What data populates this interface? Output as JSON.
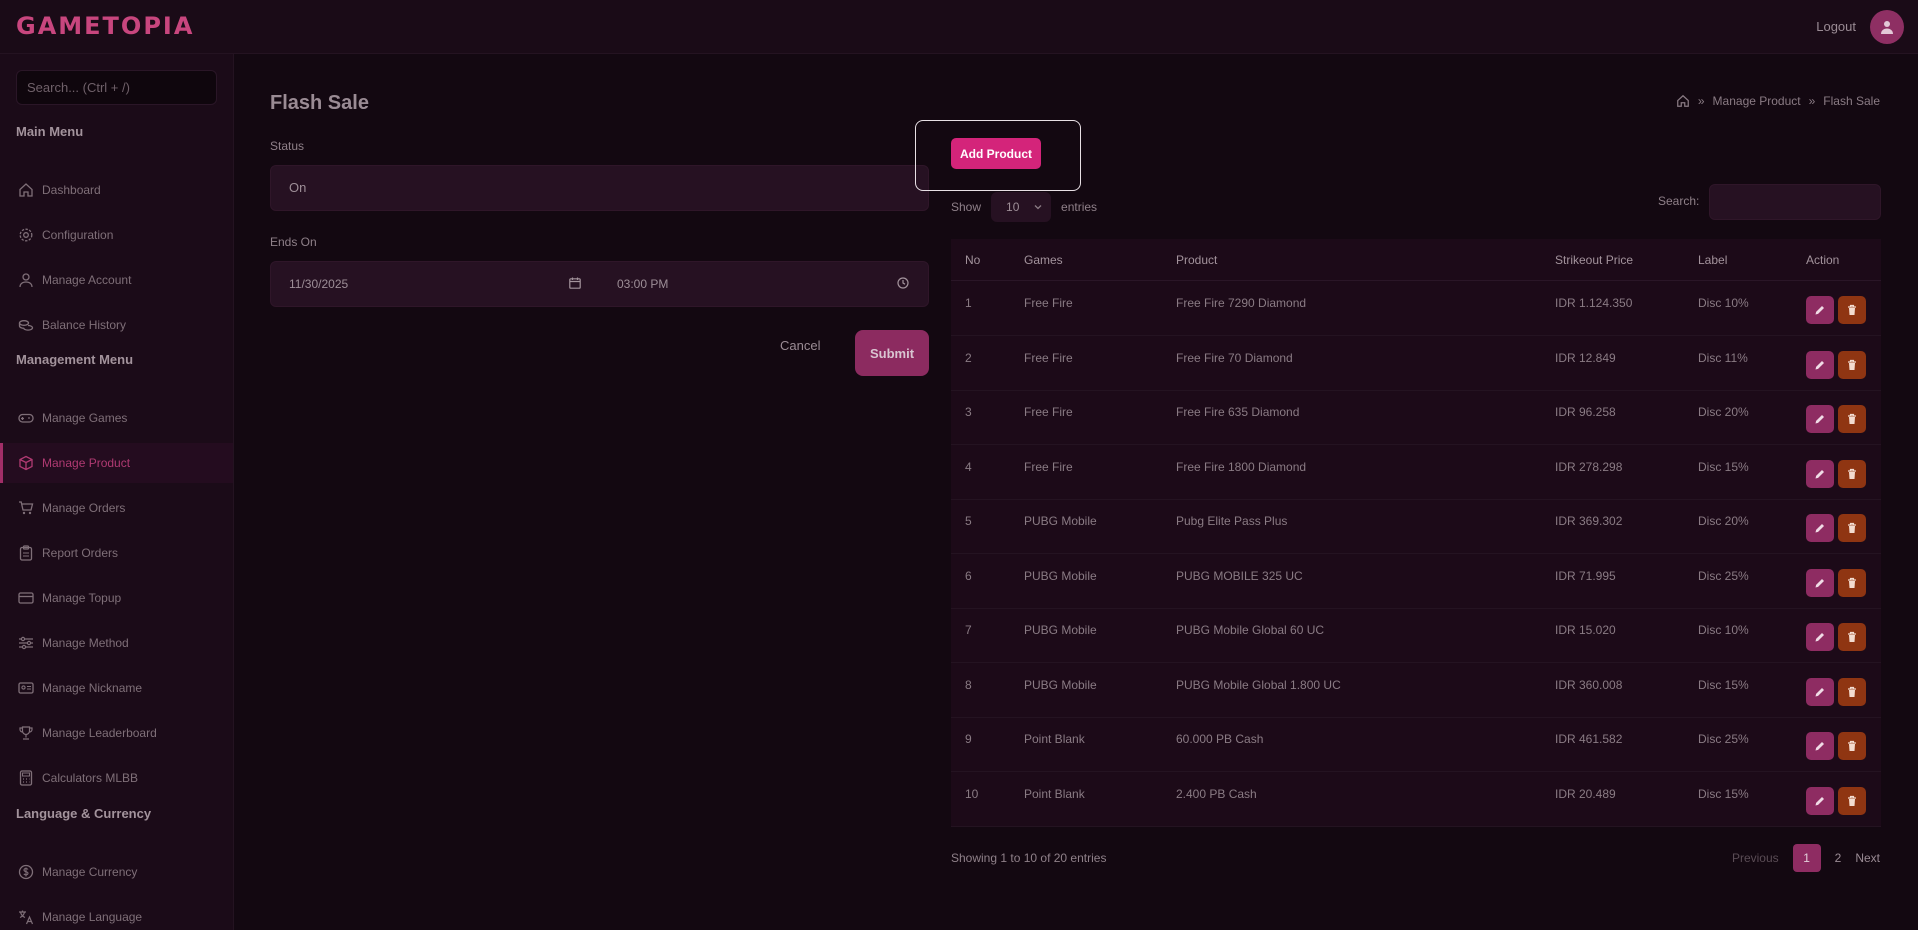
{
  "app": {
    "logo": "GAMETOPIA",
    "logout_label": "Logout",
    "search_placeholder": "Search... (Ctrl + /)"
  },
  "sidebar": {
    "main_heading": "Main Menu",
    "main_items": [
      {
        "label": "Dashboard",
        "icon": "home-icon"
      },
      {
        "label": "Configuration",
        "icon": "gear-icon"
      },
      {
        "label": "Manage Account",
        "icon": "user-icon"
      },
      {
        "label": "Balance History",
        "icon": "coins-icon"
      }
    ],
    "management_heading": "Management Menu",
    "management_items": [
      {
        "label": "Manage Games",
        "icon": "gamepad-icon"
      },
      {
        "label": "Manage Product",
        "icon": "box-icon",
        "active": true
      },
      {
        "label": "Manage Orders",
        "icon": "cart-icon"
      },
      {
        "label": "Report Orders",
        "icon": "clipboard-icon"
      },
      {
        "label": "Manage Topup",
        "icon": "card-icon"
      },
      {
        "label": "Manage Method",
        "icon": "sliders-icon"
      },
      {
        "label": "Manage Nickname",
        "icon": "id-card-icon"
      },
      {
        "label": "Manage Leaderboard",
        "icon": "trophy-icon"
      },
      {
        "label": "Calculators MLBB",
        "icon": "calculator-icon"
      }
    ],
    "lang_heading": "Language & Currency",
    "lang_items": [
      {
        "label": "Manage Currency",
        "icon": "currency-icon"
      },
      {
        "label": "Manage Language",
        "icon": "translate-icon"
      }
    ]
  },
  "page": {
    "title": "Flash Sale",
    "breadcrumb": [
      "Manage Product",
      "Flash Sale"
    ]
  },
  "form": {
    "status_label": "Status",
    "status_value": "On",
    "ends_label": "Ends On",
    "date_value": "11/30/2025",
    "time_value": "03:00 PM",
    "cancel_label": "Cancel",
    "submit_label": "Submit"
  },
  "table_controls": {
    "add_label": "Add Product",
    "show_label": "Show",
    "entries_value": "10",
    "entries_label": "entries",
    "search_label": "Search:"
  },
  "table": {
    "headers": [
      "No",
      "Games",
      "Product",
      "Strikeout Price",
      "Label",
      "Action"
    ],
    "rows": [
      [
        "1",
        "Free Fire",
        "Free Fire 7290 Diamond",
        "IDR 1.124.350",
        "Disc 10%"
      ],
      [
        "2",
        "Free Fire",
        "Free Fire 70 Diamond",
        "IDR 12.849",
        "Disc 11%"
      ],
      [
        "3",
        "Free Fire",
        "Free Fire 635 Diamond",
        "IDR 96.258",
        "Disc 20%"
      ],
      [
        "4",
        "Free Fire",
        "Free Fire 1800 Diamond",
        "IDR 278.298",
        "Disc 15%"
      ],
      [
        "5",
        "PUBG Mobile",
        "Pubg Elite Pass Plus",
        "IDR 369.302",
        "Disc 20%"
      ],
      [
        "6",
        "PUBG Mobile",
        "PUBG MOBILE 325 UC",
        "IDR 71.995",
        "Disc 25%"
      ],
      [
        "7",
        "PUBG Mobile",
        "PUBG Mobile Global 60 UC",
        "IDR 15.020",
        "Disc 10%"
      ],
      [
        "8",
        "PUBG Mobile",
        "PUBG Mobile Global 1.800 UC",
        "IDR 360.008",
        "Disc 15%"
      ],
      [
        "9",
        "Point Blank",
        "60.000 PB Cash",
        "IDR 461.582",
        "Disc 25%"
      ],
      [
        "10",
        "Point Blank",
        "2.400 PB Cash",
        "IDR 20.489",
        "Disc 15%"
      ]
    ]
  },
  "pagination": {
    "summary": "Showing 1 to 10 of 20 entries",
    "previous": "Previous",
    "pages": [
      "1",
      "2"
    ],
    "next": "Next"
  }
}
